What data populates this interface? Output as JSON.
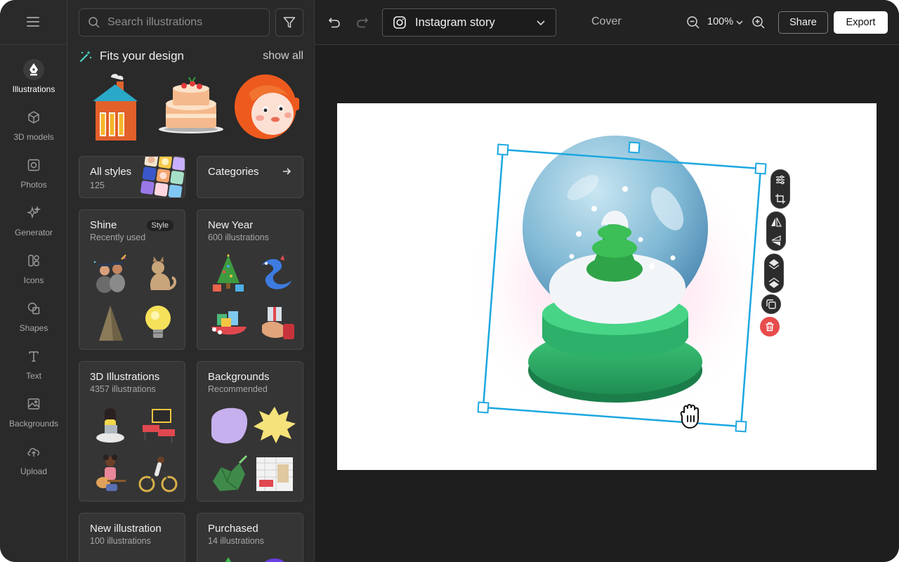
{
  "rail": {
    "items": [
      {
        "label": "Illustrations",
        "icon": "pen-nib-icon",
        "active": true
      },
      {
        "label": "3D models",
        "icon": "cube-icon"
      },
      {
        "label": "Photos",
        "icon": "photo-icon"
      },
      {
        "label": "Generator",
        "icon": "sparkles-icon"
      },
      {
        "label": "Icons",
        "icon": "icons-icon"
      },
      {
        "label": "Shapes",
        "icon": "shapes-icon"
      },
      {
        "label": "Text",
        "icon": "text-icon"
      },
      {
        "label": "Backgrounds",
        "icon": "image-icon"
      },
      {
        "label": "Upload",
        "icon": "cloud-upload-icon"
      }
    ]
  },
  "panel": {
    "search_placeholder": "Search illustrations",
    "fits_title": "Fits your design",
    "show_all": "show all",
    "all_styles": {
      "title": "All styles",
      "count": "125"
    },
    "categories": {
      "title": "Categories"
    },
    "cards": [
      {
        "title": "Shine",
        "subtitle": "Recently used",
        "badge": "Style"
      },
      {
        "title": "New Year",
        "subtitle": "600 illustrations"
      },
      {
        "title": "3D Illustrations",
        "subtitle": "4357 illustrations"
      },
      {
        "title": "Backgrounds",
        "subtitle": "Recommended"
      },
      {
        "title": "New illustration",
        "subtitle": "100 illustrations"
      },
      {
        "title": "Purchased",
        "subtitle": "14 illustrations"
      }
    ]
  },
  "topbar": {
    "format": "Instagram story",
    "cover": "Cover",
    "zoom": "100%",
    "share": "Share",
    "export": "Export"
  },
  "colors": {
    "accent": "#1aa7e0",
    "delete": "#e84c4c"
  }
}
